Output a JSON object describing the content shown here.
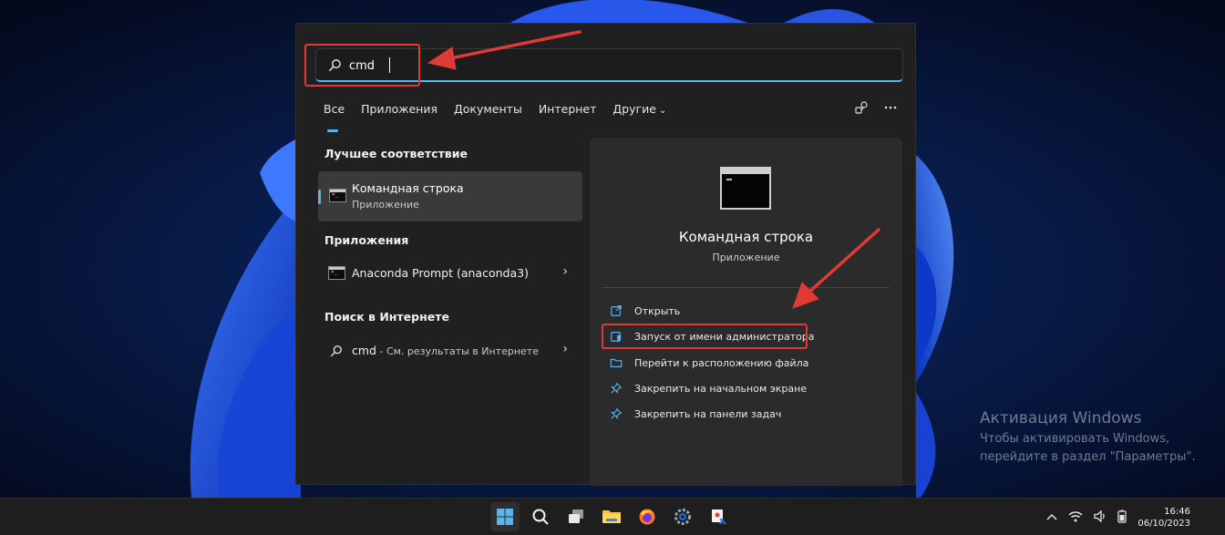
{
  "search": {
    "value": "cmd",
    "placeholder": ""
  },
  "tabs": [
    {
      "label": "Все",
      "active": true
    },
    {
      "label": "Приложения"
    },
    {
      "label": "Документы"
    },
    {
      "label": "Интернет"
    },
    {
      "label": "Другие",
      "chevron": "⌄"
    }
  ],
  "sections": {
    "best_match": "Лучшее соответствие",
    "apps": "Приложения",
    "web": "Поиск в Интернете"
  },
  "best_match": {
    "title": "Командная строка",
    "subtitle": "Приложение"
  },
  "apps_list": [
    {
      "label": "Anaconda Prompt (anaconda3)"
    }
  ],
  "web_list": [
    {
      "query": "cmd",
      "suffix": " - См. результаты в Интернете"
    }
  ],
  "detail": {
    "title": "Командная строка",
    "subtitle": "Приложение",
    "actions": [
      {
        "label": "Открыть",
        "icon": "open-icon"
      },
      {
        "label": "Запуск от имени администратора",
        "icon": "shield-icon"
      },
      {
        "label": "Перейти к расположению файла",
        "icon": "folder-icon"
      },
      {
        "label": "Закрепить на начальном экране",
        "icon": "pin-icon"
      },
      {
        "label": "Закрепить на панели задач",
        "icon": "pin-icon"
      }
    ]
  },
  "watermark": {
    "title": "Активация Windows",
    "line1": "Чтобы активировать Windows,",
    "line2": "перейдите в раздел \"Параметры\"."
  },
  "clock": {
    "time": "16:46",
    "date": "06/10/2023"
  },
  "colors": {
    "accent": "#5cb4ec",
    "highlight": "#e03a36"
  }
}
